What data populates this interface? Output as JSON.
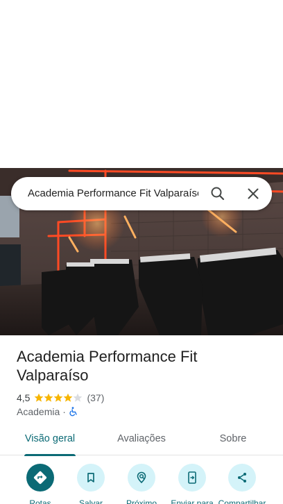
{
  "search": {
    "query": "Academia Performance Fit Valparaíso"
  },
  "place": {
    "name": "Academia Performance Fit Valparaíso",
    "rating": "4,5",
    "rating_value": 4.5,
    "reviews": "(37)",
    "category": "Academia",
    "separator": "·"
  },
  "tabs": [
    {
      "label": "Visão geral",
      "active": true
    },
    {
      "label": "Avaliações",
      "active": false
    },
    {
      "label": "Sobre",
      "active": false
    }
  ],
  "actions": [
    {
      "label": "Rotas",
      "icon": "directions-icon"
    },
    {
      "label": "Salvar",
      "icon": "bookmark-icon"
    },
    {
      "label": "Próximo",
      "icon": "nearby-icon"
    },
    {
      "label": "Enviar para",
      "icon": "send-to-phone-icon"
    },
    {
      "label": "Compartilhar",
      "icon": "share-icon"
    }
  ],
  "colors": {
    "accent": "#0b6a75",
    "action_bg": "#d4f3f9",
    "star": "#f7b500",
    "neon": "#ff5a2a",
    "accessibility": "#1a73e8"
  }
}
